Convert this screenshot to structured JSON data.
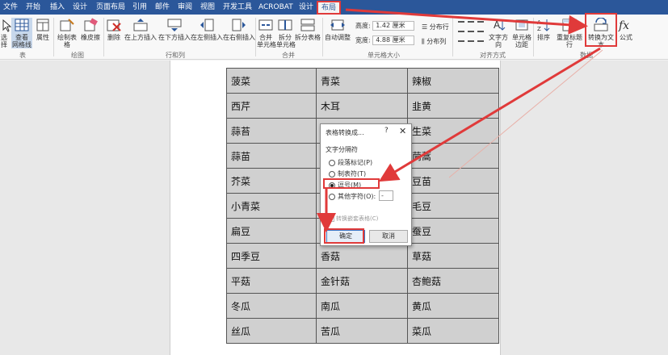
{
  "tabs": [
    "文件",
    "开始",
    "插入",
    "设计",
    "页面布局",
    "引用",
    "邮件",
    "审阅",
    "视图",
    "开发工具",
    "ACROBAT",
    "设计",
    "布局"
  ],
  "ribbon": {
    "table_group": {
      "label": "表",
      "select": "选择",
      "gridlines": "查看\n网格线",
      "properties": "属性"
    },
    "draw_group": {
      "label": "绘图",
      "draw_table": "绘制表格",
      "eraser": "橡皮擦"
    },
    "rows_cols_group": {
      "label": "行和列",
      "delete": "删除",
      "insert_above": "在上方插入",
      "insert_below": "在下方插入",
      "insert_left": "在左侧插入",
      "insert_right": "在右侧插入"
    },
    "merge_group": {
      "label": "合并",
      "merge_cells": "合并\n单元格",
      "split_cells": "拆分\n单元格",
      "split_table": "拆分表格"
    },
    "cell_size_group": {
      "label": "单元格大小",
      "autofit": "自动调整",
      "height_label": "高度:",
      "height_value": "1.42 厘米",
      "width_label": "宽度:",
      "width_value": "4.88 厘米",
      "distribute_rows": "分布行",
      "distribute_cols": "分布列"
    },
    "alignment_group": {
      "label": "对齐方式",
      "text_direction": "文字方向",
      "cell_margins": "单元格\n边距"
    },
    "data_group": {
      "label": "数据",
      "sort": "排序",
      "repeat_header": "重复标题行",
      "convert_to_text": "转换为文本",
      "formula": "公式"
    }
  },
  "table_rows": [
    [
      "菠菜",
      "青菜",
      "辣椒"
    ],
    [
      "西芹",
      "木耳",
      "韭黄"
    ],
    [
      "蒜苔",
      "",
      "生菜"
    ],
    [
      "蒜苗",
      "",
      "茼蒿"
    ],
    [
      "芥菜",
      "",
      "豆苗"
    ],
    [
      "小青菜",
      "",
      "毛豆"
    ],
    [
      "扁豆",
      "",
      "蚕豆"
    ],
    [
      "四季豆",
      "香菇",
      "草菇"
    ],
    [
      "平菇",
      "金针菇",
      "杏鲍菇"
    ],
    [
      "冬瓜",
      "南瓜",
      "黄瓜"
    ],
    [
      "丝瓜",
      "苦瓜",
      "菜瓜"
    ]
  ],
  "dialog": {
    "title": "表格转换成...",
    "help": "?",
    "close": "✕",
    "section": "文字分隔符",
    "options": [
      "段落标记(P)",
      "制表符(T)",
      "逗号(M)",
      "其他字符(O):"
    ],
    "selected_index": 2,
    "other_char_value": "-",
    "nested_tables": "转换嵌套表格(C)",
    "ok": "确定",
    "cancel": "取消"
  },
  "colors": {
    "tab_bar": "#2b579a",
    "highlight": "#e03a3a",
    "cell_fill": "#d0d0d0"
  }
}
